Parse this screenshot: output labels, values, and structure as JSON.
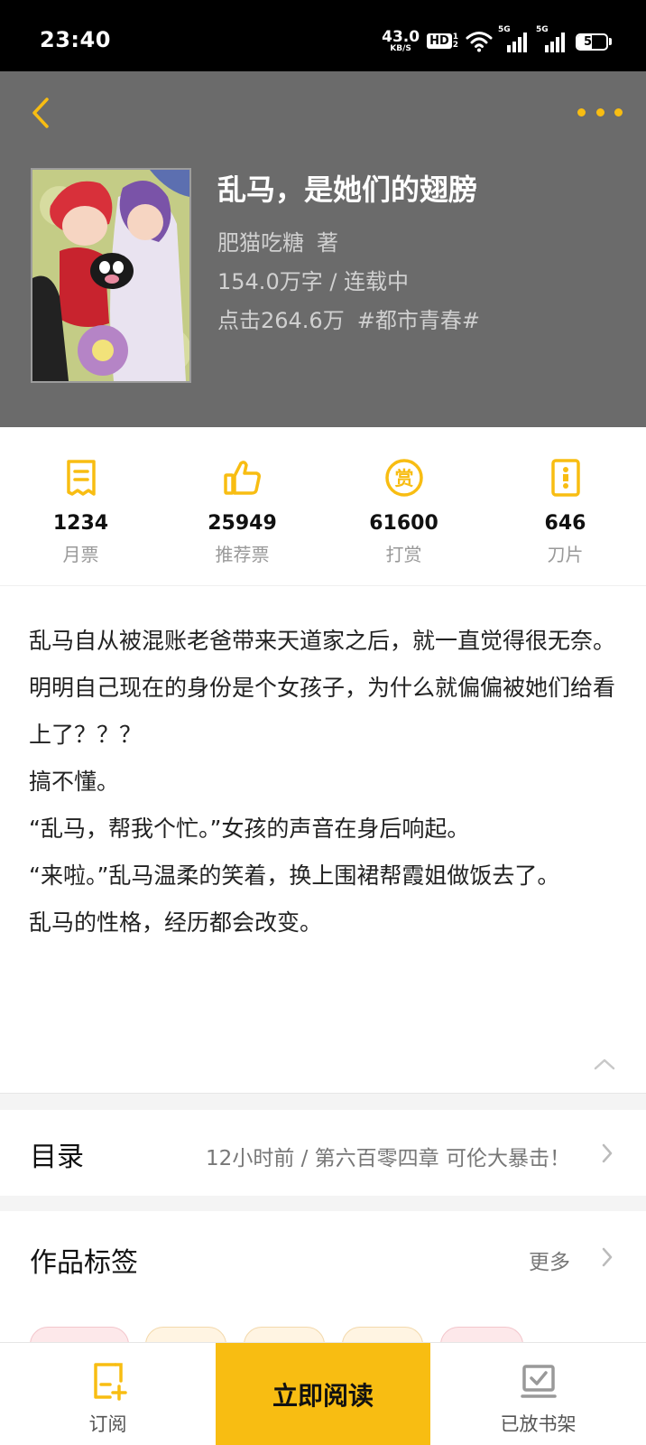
{
  "status_bar": {
    "time": "23:40",
    "net_speed_value": "43.0",
    "net_speed_unit": "KB/S",
    "hd_label": "HD",
    "network_1": "5G",
    "network_2": "5G",
    "battery_level": "51"
  },
  "book": {
    "title": "乱马，是她们的翅膀",
    "author": "肥猫吃糖",
    "author_suffix": "著",
    "word_count_status": "154.0万字 / 连载中",
    "clicks": "点击264.6万",
    "category_tag": "#都市青春#"
  },
  "stats": [
    {
      "icon": "monthly-ticket-icon",
      "value": "1234",
      "label": "月票"
    },
    {
      "icon": "thumbs-up-icon",
      "value": "25949",
      "label": "推荐票"
    },
    {
      "icon": "reward-icon",
      "value": "61600",
      "label": "打赏"
    },
    {
      "icon": "blade-icon",
      "value": "646",
      "label": "刀片"
    }
  ],
  "description": [
    "乱马自从被混账老爸带来天道家之后，就一直觉得很无奈。",
    "明明自己现在的身份是个女孩子，为什么就偏偏被她们给看上了？？？",
    "搞不懂。",
    "“乱马，帮我个忙。”女孩的声音在身后响起。",
    "“来啦。”乱马温柔的笑着，换上围裙帮霞姐做饭去了。",
    "乱马的性格，经历都会改变。"
  ],
  "catalog": {
    "title": "目录",
    "latest": "12小时前 / 第六百零四章 可伦大暴击！"
  },
  "tags_section": {
    "title": "作品标签",
    "more": "更多",
    "pill_colors": [
      "#fde8ea",
      "#fff4e2",
      "#fff4e2",
      "#fff4e2",
      "#fde8ea"
    ]
  },
  "bottom_bar": {
    "subscribe": "订阅",
    "read_now": "立即阅读",
    "on_shelf": "已放书架"
  },
  "colors": {
    "accent": "#f8bd12",
    "header_bg": "#6b6b6b"
  }
}
